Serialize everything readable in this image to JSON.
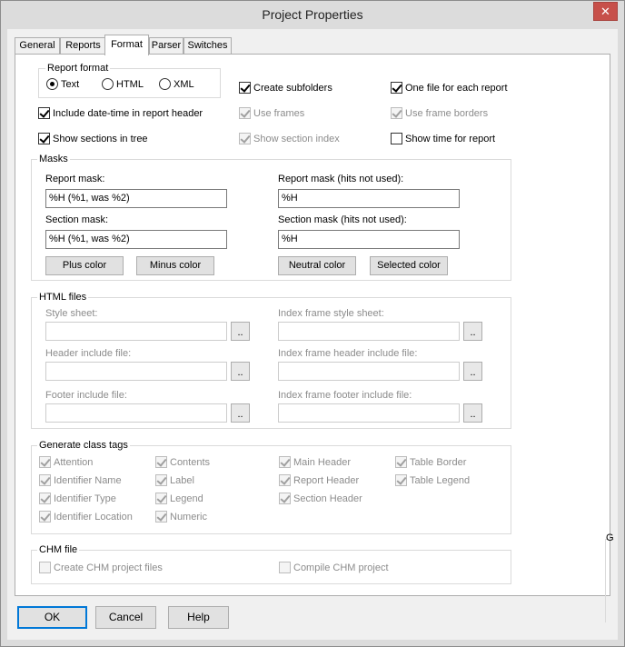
{
  "window": {
    "title": "Project Properties",
    "close_glyph": "✕"
  },
  "tabs": [
    {
      "label": "General"
    },
    {
      "label": "Reports"
    },
    {
      "label": "Format"
    },
    {
      "label": "Parser"
    },
    {
      "label": "Switches"
    }
  ],
  "report_format": {
    "title": "Report format",
    "options": [
      {
        "label": "Text",
        "selected": true
      },
      {
        "label": "HTML",
        "selected": false
      },
      {
        "label": "XML",
        "selected": false
      }
    ]
  },
  "options": {
    "create_subfolders": "Create subfolders",
    "one_file_each_report": "One file for each report",
    "include_datetime": "Include date-time in report header",
    "use_frames": "Use frames",
    "use_frame_borders": "Use frame borders",
    "show_sections_tree": "Show sections in tree",
    "show_section_index": "Show section index",
    "show_time": "Show time for report"
  },
  "masks": {
    "title": "Masks",
    "report_mask_label": "Report mask:",
    "report_mask_value": "%H (%1, was %2)",
    "report_mask_nohits_label": "Report mask (hits not used):",
    "report_mask_nohits_value": "%H",
    "section_mask_label": "Section mask:",
    "section_mask_value": "%H (%1, was %2)",
    "section_mask_nohits_label": "Section mask (hits not used):",
    "section_mask_nohits_value": "%H",
    "plus_color": "Plus color",
    "minus_color": "Minus color",
    "neutral_color": "Neutral color",
    "selected_color": "Selected color"
  },
  "html_files": {
    "title": "HTML files",
    "style_sheet": "Style sheet:",
    "index_style_sheet": "Index frame style sheet:",
    "header_include": "Header include file:",
    "index_header_include": "Index frame header include file:",
    "footer_include": "Footer include file:",
    "index_footer_include": "Index frame footer include file:",
    "browse": ".."
  },
  "class_tags": {
    "title": "Generate class tags",
    "items": [
      "Attention",
      "Contents",
      "Main Header",
      "Table Border",
      "Identifier Name",
      "Label",
      "Report Header",
      "Table Legend",
      "Identifier Type",
      "Legend",
      "Section Header",
      "Identifier Location",
      "Numeric"
    ]
  },
  "chm": {
    "title": "CHM file",
    "create": "Create CHM project files",
    "compile": "Compile CHM project"
  },
  "side_fragment": "G",
  "buttons": {
    "ok": "OK",
    "cancel": "Cancel",
    "help": "Help"
  },
  "colors": {
    "accent": "#0078d7",
    "close": "#c7504a"
  }
}
